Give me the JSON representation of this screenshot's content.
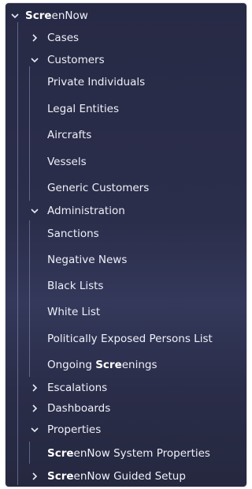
{
  "tree": {
    "root": {
      "highlight": "Scre",
      "rest": "enNow"
    },
    "cases": "Cases",
    "customers": "Customers",
    "customer_items": [
      "Private Individuals",
      "Legal Entities",
      "Aircrafts",
      "Vessels",
      "Generic Customers"
    ],
    "administration": "Administration",
    "admin_items": [
      "Sanctions",
      "Negative News",
      "Black Lists",
      "White List",
      "Politically Exposed Persons List"
    ],
    "ongoing": {
      "highlight": "Scre",
      "rest": "enings",
      "prefix": "Ongoing "
    },
    "escalations": "Escalations",
    "dashboards": "Dashboards",
    "properties": "Properties",
    "system_properties": {
      "highlight": "Scre",
      "rest": "enNow System Properties"
    },
    "guided_setup": {
      "highlight": "Scre",
      "rest": "enNow Guided Setup"
    }
  },
  "icons": {
    "expanded": "chevron-down-icon",
    "collapsed": "chevron-right-icon"
  }
}
